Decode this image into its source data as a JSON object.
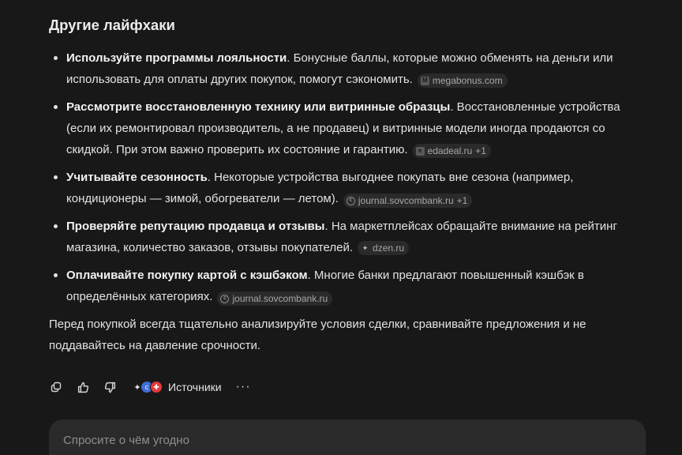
{
  "section": {
    "heading": "Другие лайфхаки"
  },
  "tips": [
    {
      "bold": "Используйте программы лояльности",
      "text": ". Бонусные баллы, которые можно обменять на деньги или использовать для оплаты других покупок, помогут сэкономить.",
      "source": "megabonus.com",
      "source_icon": "megabonus-icon",
      "source_extra": ""
    },
    {
      "bold": "Рассмотрите восстановленную технику или витринные образцы",
      "text": ". Восстановленные устройства (если их ремонтировал производитель, а не продавец) и витринные модели иногда продаются со скидкой. При этом важно проверить их состояние и гарантию.",
      "source": "edadeal.ru",
      "source_icon": "edadeal-icon",
      "source_extra": "+1"
    },
    {
      "bold": "Учитывайте сезонность",
      "text": ". Некоторые устройства выгоднее покупать вне сезона (например, кондиционеры — зимой, обогреватели — летом).",
      "source": "journal.sovcombank.ru",
      "source_icon": "sovcombank-icon",
      "source_extra": "+1"
    },
    {
      "bold": "Проверяйте репутацию продавца и отзывы",
      "text": ". На маркетплейсах обращайте внимание на рейтинг магазина, количество заказов, отзывы покупателей.",
      "source": "dzen.ru",
      "source_icon": "dzen-icon",
      "source_extra": ""
    },
    {
      "bold": "Оплачивайте покупку картой с кэшбэком",
      "text": ". Многие банки предлагают повышенный кэшбэк в определённых категориях.",
      "source": "journal.sovcombank.ru",
      "source_icon": "sovcombank-icon",
      "source_extra": ""
    }
  ],
  "closing_paragraph": "Перед покупкой всегда тщательно анализируйте условия сделки, сравнивайте предложения и не поддавайтесь на давление срочности.",
  "actions": {
    "copy_icon": "copy-icon",
    "like_icon": "thumbs-up-icon",
    "dislike_icon": "thumbs-down-icon",
    "sources_label": "Источники",
    "more_label": "···"
  },
  "composer": {
    "placeholder": "Спросите о чём угодно"
  }
}
